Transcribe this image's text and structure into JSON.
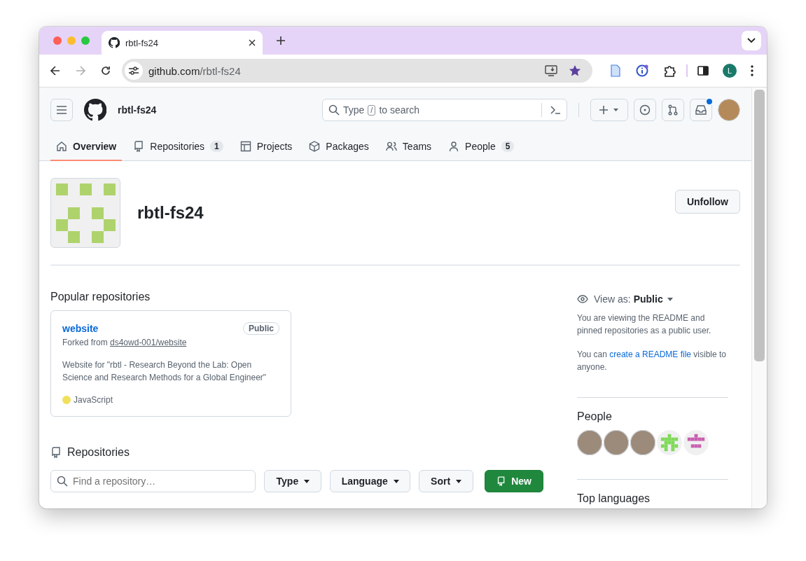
{
  "browser": {
    "tab_title": "rbtl-fs24",
    "url_host": "github.com",
    "url_path": "/rbtl-fs24",
    "forward_disabled": true,
    "profile_letter": "L"
  },
  "header": {
    "org_name": "rbtl-fs24",
    "search": {
      "prefix": "Type",
      "key": "/",
      "suffix": "to search"
    },
    "notification_unread": true
  },
  "nav": [
    {
      "label": "Overview",
      "selected": true
    },
    {
      "label": "Repositories",
      "count": "1",
      "selected": false
    },
    {
      "label": "Projects",
      "selected": false
    },
    {
      "label": "Packages",
      "selected": false
    },
    {
      "label": "Teams",
      "selected": false
    },
    {
      "label": "People",
      "count": "5",
      "selected": false
    }
  ],
  "profile": {
    "name": "rbtl-fs24",
    "follow_button": "Unfollow"
  },
  "popular": {
    "heading": "Popular repositories",
    "cards": [
      {
        "name": "website",
        "visibility": "Public",
        "fork_prefix": "Forked from",
        "fork_source": "ds4owd-001/website",
        "description": "Website for \"rbtl - Research Beyond the Lab: Open Science and Research Methods for a Global Engineer\"",
        "language": "JavaScript",
        "color": "#f1e05a"
      }
    ]
  },
  "repositories": {
    "heading": "Repositories",
    "search_placeholder": "Find a repository…",
    "filters": [
      "Type",
      "Language",
      "Sort"
    ],
    "new_button": "New"
  },
  "sidebar": {
    "view_as_label": "View as:",
    "view_as_value": "Public",
    "note": "You are viewing the README and pinned repositories as a public user.",
    "readme_prefix": "You can",
    "readme_link": "create a README file",
    "readme_suffix": "visible to anyone.",
    "people_heading": "People",
    "people": [
      {
        "kind": "photo"
      },
      {
        "kind": "photo"
      },
      {
        "kind": "photo"
      },
      {
        "kind": "identicon",
        "color": "#7ed957"
      },
      {
        "kind": "identicon",
        "color": "#c85fb0"
      }
    ],
    "languages_heading": "Top languages"
  }
}
